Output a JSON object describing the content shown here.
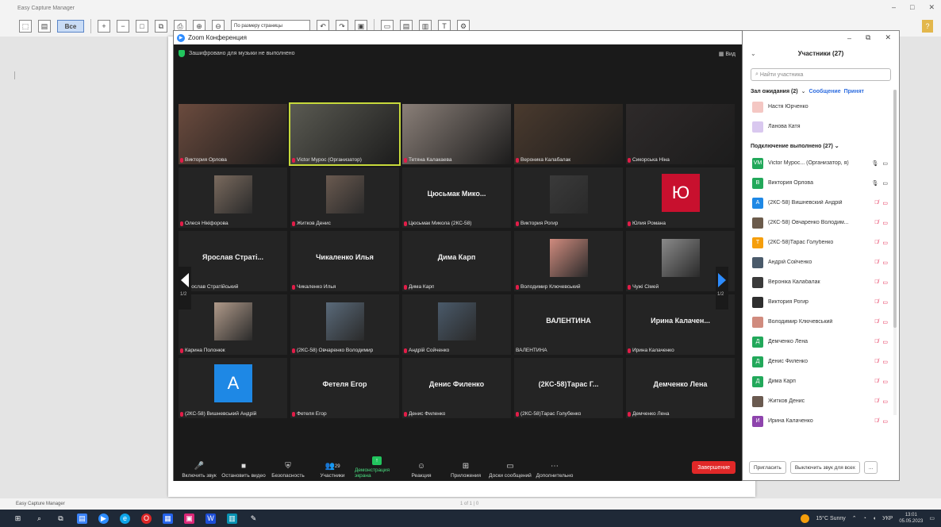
{
  "outer_app": {
    "title": "Easy Capture Manager",
    "zoom_select": "По размеру страницы",
    "toolbar_sel_label": "Все",
    "status_left": "Easy Capture Manager",
    "status_center": "1 of 1 | 0",
    "help_icon": "question-icon"
  },
  "zoom": {
    "window_title": "Zoom Конференция",
    "encryption_text": "Зашифровано для музыки не выполнено",
    "view_label": "Вид",
    "page_indicator_left": "1/2",
    "page_indicator_right": "1/2",
    "tiles": [
      {
        "label": "Виктория Орлова",
        "type": "video",
        "bg": "#6b4b3e"
      },
      {
        "label": "Victor Мурос (Организатор)",
        "type": "video",
        "bg": "#5a5a52",
        "active": true
      },
      {
        "label": "Тетяна Калакаева",
        "type": "video",
        "bg": "#8a7f78"
      },
      {
        "label": "Вероника Калабалак",
        "type": "video",
        "bg": "#4a3a2e"
      },
      {
        "label": "Сикорська Ніна",
        "type": "video",
        "bg": "#2e2a2a"
      },
      {
        "label": "Олеся Нікіфорова",
        "type": "video_small",
        "bg": "#7a6a5e"
      },
      {
        "label": "Житков Денис",
        "type": "video_small",
        "bg": "#6a5a50"
      },
      {
        "label": "Цюсьмак Микола (2КС-58)",
        "type": "name",
        "name": "Цюсьмак Мико..."
      },
      {
        "label": "Виктория Рогир",
        "type": "video_small",
        "bg": "#3a3a3a"
      },
      {
        "label": "Юлия Романа",
        "type": "avatar",
        "letter": "Ю",
        "color": "#c8102e"
      },
      {
        "label": "Ярослав Стратійський",
        "type": "name",
        "name": "Ярослав Страті..."
      },
      {
        "label": "Чикаленко Илья",
        "type": "name",
        "name": "Чикаленко Илья"
      },
      {
        "label": "Дима Карп",
        "type": "name",
        "name": "Дима Карп"
      },
      {
        "label": "Володимир Ключевський",
        "type": "video_small",
        "bg": "#d08b7e"
      },
      {
        "label": "Чужі Сімей",
        "type": "video_small",
        "bg": "#8a8a8a"
      },
      {
        "label": "Карина Полонюк",
        "type": "video_small",
        "bg": "#b09a8a"
      },
      {
        "label": "(2КС-58) Овчаренко Володимир",
        "type": "video_small",
        "bg": "#5a6a7a"
      },
      {
        "label": "Андрій Сойченко",
        "type": "video_small",
        "bg": "#4a5a6a"
      },
      {
        "label": "ВАЛЕНТИНА",
        "type": "name",
        "name": "ВАЛЕНТИНА",
        "no_mute": true
      },
      {
        "label": "Ирина Калаченко",
        "type": "name",
        "name": "Ирина Калачен..."
      },
      {
        "label": "(2КС-58) Вишневський Андрій",
        "type": "avatar",
        "letter": "А",
        "color": "#1e88e5"
      },
      {
        "label": "Фетеля Егор",
        "type": "name",
        "name": "Фетеля Егор"
      },
      {
        "label": "Денис Филенко",
        "type": "name",
        "name": "Денис Филенко"
      },
      {
        "label": "(2КС-58)Тарас Голубенко",
        "type": "name",
        "name": "(2КС-58)Тарас Г..."
      },
      {
        "label": "Демченко Лена",
        "type": "name",
        "name": "Демченко Лена"
      }
    ],
    "controls": [
      {
        "label": "Включить звук",
        "icon": "mic-icon",
        "glyph": "🎤"
      },
      {
        "label": "Остановить видео",
        "icon": "video-icon",
        "glyph": "■"
      },
      {
        "label": "Безопасность",
        "icon": "shield-icon",
        "glyph": "⛨"
      },
      {
        "label": "Участники",
        "icon": "participants-icon",
        "glyph": "👥",
        "count": "29"
      },
      {
        "label": "Демонстрация экрана",
        "icon": "share-screen-icon",
        "glyph": "↑",
        "green": true
      },
      {
        "label": "Реакция",
        "icon": "reaction-icon",
        "glyph": "☺"
      },
      {
        "label": "Приложения",
        "icon": "apps-icon",
        "glyph": "⊞"
      },
      {
        "label": "Доски сообщений",
        "icon": "whiteboard-icon",
        "glyph": "▭"
      },
      {
        "label": "Дополнительно",
        "icon": "more-icon",
        "glyph": "⋯"
      }
    ],
    "end_label": "Завершение"
  },
  "panel": {
    "title": "Участники (27)",
    "search_placeholder": "Найти участника",
    "waiting_label": "Зал ожидания (2)",
    "message_link": "Сообщение",
    "admit_link": "Принят",
    "waiting": [
      {
        "name": "Настя Юрченко",
        "color": "#f4c7c3"
      },
      {
        "name": "Ланова Катя",
        "color": "#d9c8ef"
      }
    ],
    "connected_label": "Подключение выполнено (27)",
    "participants": [
      {
        "name": "Victor Мурос... (Организатор, я)",
        "letter": "VM",
        "color": "#22a85a",
        "icons": "🎙 ▭",
        "muted": false
      },
      {
        "name": "Виктория Орлова",
        "letter": "В",
        "color": "#22a85a",
        "icons": "🎙 ▭",
        "muted": false
      },
      {
        "name": "(2КС-58) Вишневский Андрій",
        "letter": "А",
        "color": "#1e88e5",
        "icons": "🎙 ▭",
        "muted": true
      },
      {
        "name": "(2КС-58) Овчаренко Володим...",
        "letter": "",
        "color": "#6b5b4b",
        "icons": "🎙 ▭",
        "muted": true
      },
      {
        "name": "(2КС-58)Тарас Голубенко",
        "letter": "Т",
        "color": "#f59e0b",
        "icons": "🎙 ▭",
        "muted": true
      },
      {
        "name": "Андрій Сойченко",
        "letter": "",
        "color": "#4a5a6a",
        "icons": "🎙 ▭",
        "muted": true
      },
      {
        "name": "Вероніка Калабалак",
        "letter": "",
        "color": "#3a3a3a",
        "icons": "🎙 ▭",
        "muted": true
      },
      {
        "name": "Виктория Рогир",
        "letter": "",
        "color": "#2e2e2e",
        "icons": "🎙 ▭",
        "muted": true
      },
      {
        "name": "Володимир Ключевський",
        "letter": "",
        "color": "#d08b7e",
        "icons": "🎙 ▭",
        "muted": true
      },
      {
        "name": "Демченко Лена",
        "letter": "Д",
        "color": "#22a85a",
        "icons": "🎙 ▭",
        "muted": true
      },
      {
        "name": "Денис Филенко",
        "letter": "Д",
        "color": "#22a85a",
        "icons": "🎙 ▭",
        "muted": true
      },
      {
        "name": "Дима Карп",
        "letter": "Д",
        "color": "#22a85a",
        "icons": "🎙 ▭",
        "muted": true
      },
      {
        "name": "Житков Денис",
        "letter": "",
        "color": "#6a5a50",
        "icons": "🎙 ▭",
        "muted": true
      },
      {
        "name": "Ирина Калаченко",
        "letter": "И",
        "color": "#8e44ad",
        "icons": "🎙 ▭",
        "muted": true
      }
    ],
    "invite_label": "Пригласить",
    "mute_all_label": "Выключить звук для всех",
    "more_label": "..."
  },
  "taskbar": {
    "weather": "15°C Sunny",
    "lang": "УКР",
    "time": "13:01",
    "date": "05.05.2023"
  }
}
